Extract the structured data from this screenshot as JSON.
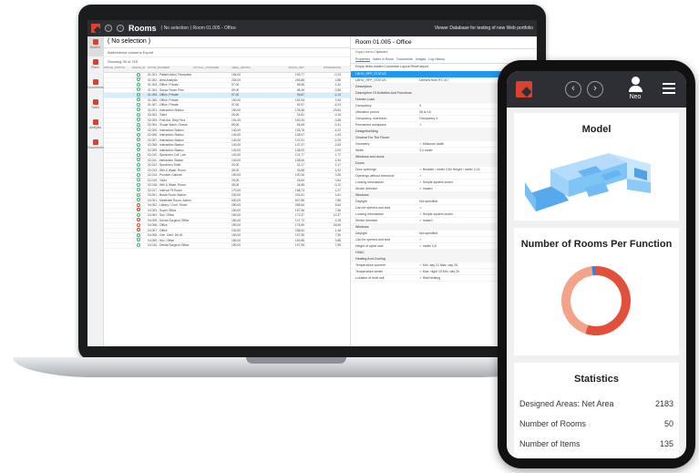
{
  "laptop": {
    "title": "Rooms",
    "crumb": "( No selection )  Room 01.005 - Office",
    "top_right": "Viewer  Database for testing of new Web  portfolio",
    "nav": [
      "Rooms",
      "Plans",
      "Documents",
      "Tasks",
      "Analysis",
      "Documents"
    ],
    "list_title": "( No selection )",
    "list_tools": "Add/remove columns   Export",
    "list_count": "Showing 35 of 219",
    "columns": [
      "SPACE_STATUS",
      "SPACE_ID",
      "ROOM_NUMBER",
      "ACTUAL_TOPDAME",
      "AREA_GROSS",
      "SPACE_NET",
      "DIFFERENCE"
    ],
    "rows": [
      [
        "01.001 - Patient Admi. Reception",
        "154,00",
        "153,77",
        "-0,23"
      ],
      [
        "01.002 - Area Analysis",
        "204,00",
        "206,88",
        "2,88"
      ],
      [
        "01.003 - Office, Private",
        "97,00",
        "95,58",
        "-1,42"
      ],
      [
        "01.004 - Senior Room Pers",
        "59,00",
        "58,45",
        "-0,55"
      ],
      [
        "01.005 - Office, Private",
        "97,00",
        "95,87",
        "-1,13"
      ],
      [
        "01.006 - Office, Private",
        "150,00",
        "152,94",
        "2,94"
      ],
      [
        "01.007 - Office, Private",
        "97,00",
        "92,97",
        "-4,03"
      ],
      [
        "02.001 - Interaction Station",
        "150,00",
        "126,36",
        "-23,64"
      ],
      [
        "02.002 - Toilet",
        "25,00",
        "24,81",
        "-0,19"
      ],
      [
        "02.003 - First Aid, Strip Pers",
        "151,00",
        "150,34",
        "-0,66"
      ],
      [
        "02.004 - Scope Wash, Gloves",
        "85,00",
        "84,69",
        "-0,31"
      ],
      [
        "02.005 - Interaction Station",
        "140,00",
        "135,78",
        "-4,22"
      ],
      [
        "02.006 - Interaction Station",
        "140,00",
        "138,07",
        "-1,93"
      ],
      [
        "02.007 - Interaction Station",
        "140,00",
        "137,91",
        "-2,09"
      ],
      [
        "02.008 - Interaction Station",
        "140,00",
        "137,37",
        "-2,63"
      ],
      [
        "02.009 - Interaction Station",
        "140,00",
        "138,00",
        "-2,00"
      ],
      [
        "02.010 - Specimen Coll. Lab",
        "100,00",
        "101,77",
        "1,77"
      ],
      [
        "02.011 - Interaction Station",
        "140,00",
        "138,06",
        "-1,94"
      ],
      [
        "02.012 - Specimen Toilet",
        "30,00",
        "31,17",
        "1,17"
      ],
      [
        "02.013 - Wth & Wash. Room",
        "35,00",
        "33,68",
        "-1,32"
      ],
      [
        "02.014 - Provider Cabinet",
        "190,00",
        "190,26",
        "0,26"
      ],
      [
        "02.015 - Toilet",
        "25,00",
        "25,64",
        "0,64"
      ],
      [
        "02.016 - Wth & Wash. Room",
        "35,00",
        "34,88",
        "-0,12"
      ],
      [
        "02.017 - Interval Fil Room",
        "170,00",
        "168,73",
        "-1,27"
      ],
      [
        "03.001 - Break Room Station",
        "230,00",
        "231,61",
        "1,61"
      ],
      [
        "04.001 - Meetinkel Room, Admin",
        "630,00",
        "637,86",
        "7,86"
      ],
      [
        "04.002 - Library / Conf. Room",
        "280,00",
        "285,64",
        "5,64"
      ],
      [
        "04.003 - Super Office",
        "150,00",
        "157,96",
        "7,96"
      ],
      [
        "04.004 - Sec. Office",
        "160,00",
        "172,37",
        "12,37"
      ],
      [
        "04.005 - Dental Surgeon Office",
        "150,00",
        "147,72",
        "-2,28"
      ],
      [
        "04.006 - Office",
        "150,00",
        "176,69",
        "26,69"
      ],
      [
        "04.007 - Office",
        "240,00",
        "238,52",
        "-1,48"
      ],
      [
        "04.008 - Gen. Dent. Dir #1",
        "150,00",
        "157,59",
        "7,59"
      ],
      [
        "04.009 - Sec. Office",
        "150,00",
        "150,88",
        "0,88"
      ],
      [
        "04.010 - Dental Surgeon Office",
        "150,00",
        "157,59",
        "7,59"
      ]
    ],
    "detail": {
      "title": "Room 01.005 - Office",
      "sub": "Copy Link to Clipboard",
      "tabs": [
        "Properties",
        "Notes in Room",
        "Documents",
        "Images",
        "Log History"
      ],
      "buttons": "Empty fields hidden   Customize Layout   Reset layout",
      "blue": "LBHO_RFP_STATUS",
      "lines": [
        [
          "LBHO_RFP_STATUS",
          "Derived from RT-017"
        ],
        [
          "Description",
          ""
        ],
        [
          "Description Of Activities And Functions",
          ""
        ],
        [
          "Human Load",
          ""
        ],
        [
          "Occupancy",
          "3"
        ],
        [
          "Utilization period",
          "08     to  16"
        ],
        [
          "Occupancy, maximum",
          "Occupancy 4"
        ],
        [
          "Permanent workplace",
          "✓"
        ],
        [
          "Design/building",
          ""
        ],
        [
          "General For The Room",
          ""
        ],
        [
          "Geometry",
          "✓ Minimum width"
        ],
        [
          "Width",
          "3,3     meter"
        ],
        [
          "Windows and doors",
          ""
        ],
        [
          "Doors",
          ""
        ],
        [
          "Door openings",
          "✓ Breadth / meter 0,84   Height / meter 2,04"
        ],
        [
          "Openings without threshold",
          "✓"
        ],
        [
          "Locking mechanism",
          "✓ Simple system locker"
        ],
        [
          "Stroke direction",
          "✓ Inward"
        ],
        [
          "Windows",
          ""
        ],
        [
          "Daylight",
          "Not specified"
        ],
        [
          "Can be opened and shut",
          "✓"
        ],
        [
          "Locking mechanism",
          "✓ Simple system locker"
        ],
        [
          "Stroke direction",
          "✓ Inward"
        ],
        [
          "Windows",
          ""
        ],
        [
          "Daylight",
          "Not specified"
        ],
        [
          "Can be opened and shut",
          "✓"
        ],
        [
          "Height of spine wall",
          "✓ meter 0,6"
        ],
        [
          "HVAC",
          ""
        ],
        [
          "Heating And Cooling",
          ""
        ],
        [
          "Temperature summer",
          "✓ Min. day 21   Max. day 26"
        ],
        [
          "Temperature winter",
          "✓ Max. night 15   Min. day 20"
        ],
        [
          "Location of heat unit",
          "✓ Wall heating"
        ]
      ]
    }
  },
  "phone": {
    "user": "Neo",
    "model_title": "Model",
    "rooms_title": "Number of Rooms Per Function",
    "stats_title": "Statistics",
    "stats": [
      {
        "label": "Designed Areas: Net Area",
        "value": "2183"
      },
      {
        "label": "Number of Rooms",
        "value": "50"
      },
      {
        "label": "Number of Items",
        "value": "135"
      }
    ],
    "donut": [
      {
        "fraction": 0.55,
        "color": "#e2503b"
      },
      {
        "fraction": 0.43,
        "color": "#f4a38b"
      },
      {
        "fraction": 0.02,
        "color": "#3f7fd6"
      }
    ],
    "accent": "#d8432f"
  }
}
